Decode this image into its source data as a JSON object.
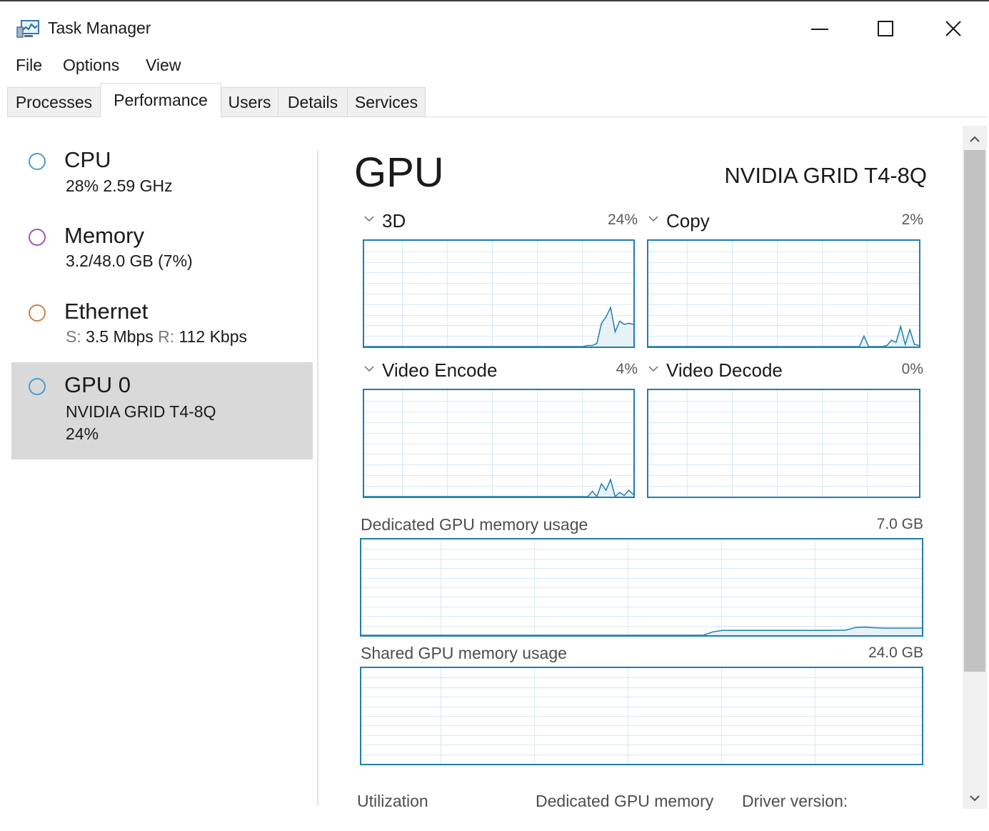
{
  "window": {
    "title": "Task Manager"
  },
  "menu": [
    "File",
    "Options",
    "View"
  ],
  "tabs": [
    "Processes",
    "Performance",
    "Users",
    "Details",
    "Services"
  ],
  "resources": [
    {
      "name": "CPU",
      "sub1": "28% 2.59 GHz",
      "sub2": "",
      "ring_color": "#4a9bd1"
    },
    {
      "name": "Memory",
      "sub1": "3.2/48.0 GB (7%)",
      "sub2": "",
      "ring_color": "#a052b8"
    },
    {
      "name": "Ethernet",
      "sub1_send_label": "S:",
      "sub1_send": "3.5 Mbps",
      "sub1_recv_label": "R:",
      "sub1_recv": "112 Kbps",
      "ring_color": "#c8824a"
    },
    {
      "name": "GPU 0",
      "sub1": "NVIDIA GRID T4-8Q",
      "sub2": "24%",
      "ring_color": "#4a9bd1",
      "selected": true
    }
  ],
  "gpu": {
    "title": "GPU",
    "model": "NVIDIA GRID T4-8Q",
    "engines": [
      {
        "label": "3D",
        "percent": "24%"
      },
      {
        "label": "Copy",
        "percent": "2%"
      },
      {
        "label": "Video Encode",
        "percent": "4%"
      },
      {
        "label": "Video Decode",
        "percent": "0%"
      }
    ],
    "dedicated_memory": {
      "label": "Dedicated GPU memory usage",
      "max": "7.0 GB"
    },
    "shared_memory": {
      "label": "Shared GPU memory usage",
      "max": "24.0 GB"
    },
    "bottom_labels": [
      "Utilization",
      "Dedicated GPU memory",
      "Driver version:"
    ]
  },
  "series": {
    "3d": [
      0,
      0,
      0,
      0,
      0,
      0,
      0,
      0,
      0,
      0,
      0,
      0,
      0,
      0,
      0,
      0,
      0,
      0,
      0,
      0,
      0,
      0,
      0,
      0,
      0,
      0,
      0,
      0,
      0,
      0,
      0,
      0,
      0,
      0,
      0,
      0,
      0,
      0,
      0,
      0,
      0,
      0,
      0,
      0,
      0,
      0,
      0,
      0,
      0,
      1,
      1,
      3,
      22,
      28,
      37,
      14,
      24,
      21,
      22,
      21
    ],
    "copy": [
      0,
      0,
      0,
      0,
      0,
      0,
      0,
      0,
      0,
      0,
      0,
      0,
      0,
      0,
      0,
      0,
      0,
      0,
      0,
      0,
      0,
      0,
      0,
      0,
      0,
      0,
      0,
      0,
      0,
      0,
      0,
      0,
      0,
      0,
      0,
      0,
      0,
      0,
      0,
      0,
      0,
      0,
      0,
      0,
      0,
      0,
      0,
      10,
      0,
      0,
      0,
      0,
      1,
      6,
      4,
      19,
      2,
      16,
      2,
      1
    ],
    "video_encode": [
      0,
      0,
      0,
      0,
      0,
      0,
      0,
      0,
      0,
      0,
      0,
      0,
      0,
      0,
      0,
      0,
      0,
      0,
      0,
      0,
      0,
      0,
      0,
      0,
      0,
      0,
      0,
      0,
      0,
      0,
      0,
      0,
      0,
      0,
      0,
      0,
      0,
      0,
      0,
      0,
      0,
      0,
      0,
      0,
      0,
      0,
      0,
      0,
      0,
      0,
      5,
      0,
      12,
      6,
      16,
      0,
      4,
      1,
      6,
      2
    ],
    "video_decode": [],
    "dedicated_memory": [
      0,
      0,
      0,
      0,
      0,
      0,
      0,
      0,
      0,
      0,
      0,
      0,
      0,
      0,
      0,
      0,
      0,
      0,
      0,
      0,
      0,
      0,
      0,
      0,
      0,
      0,
      0,
      0,
      0,
      0,
      0,
      0,
      0,
      0,
      0,
      0,
      0,
      3.5,
      5.0,
      5.0,
      5.0,
      5.0,
      5.0,
      5.0,
      5.0,
      5.0,
      5.0,
      5.0,
      5.0,
      5.0,
      5.1,
      5.3,
      8.0,
      8.5,
      7.8,
      7.5,
      7.5,
      7.5,
      7.5,
      7.5
    ],
    "shared_memory": []
  }
}
